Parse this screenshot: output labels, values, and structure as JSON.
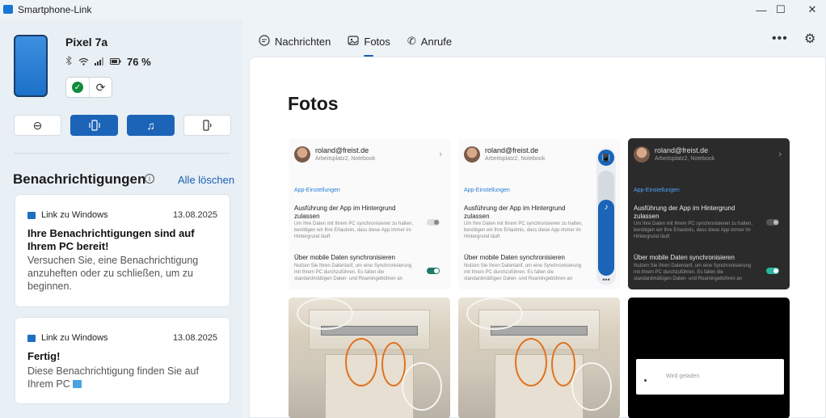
{
  "window": {
    "title": "Smartphone-Link",
    "minimize": "—",
    "maximize": "☐",
    "close": "✕"
  },
  "device": {
    "name": "Pixel 7a",
    "battery": "76 %",
    "status_icons": [
      "bluetooth-icon",
      "wifi-icon",
      "signal-icon",
      "battery-icon"
    ],
    "connected_glyph": "✓",
    "sync_glyph": "⟳"
  },
  "modes": [
    {
      "name": "do-not-disturb",
      "glyph": "⊖",
      "active": false
    },
    {
      "name": "vibrate",
      "glyph": "📳",
      "active": true
    },
    {
      "name": "ring",
      "glyph": "♫",
      "active": true
    },
    {
      "name": "audio-output",
      "glyph": "🔈",
      "active": false
    }
  ],
  "notifications": {
    "heading": "Benachrichtigungen",
    "info_glyph": "i",
    "clear_all": "Alle löschen",
    "cards": [
      {
        "app": "Link zu Windows",
        "date": "13.08.2025",
        "title": "Ihre Benachrichtigungen sind auf Ihrem PC bereit!",
        "body": "Versuchen Sie, eine Benachrichtigung anzuheften oder zu schließen, um zu beginnen."
      },
      {
        "app": "Link zu Windows",
        "date": "13.08.2025",
        "title": "Fertig!",
        "body": "Diese Benachrichtigung finden Sie auf Ihrem PC"
      }
    ]
  },
  "tabs": [
    {
      "label": "Nachrichten",
      "icon": "chat-icon",
      "glyph": "💬",
      "active": false
    },
    {
      "label": "Fotos",
      "icon": "photo-icon",
      "glyph": "🖼",
      "active": true
    },
    {
      "label": "Anrufe",
      "icon": "phone-icon",
      "glyph": "✆",
      "active": false
    }
  ],
  "toolbar": {
    "more_glyph": "•••",
    "settings_glyph": "⚙"
  },
  "main": {
    "title": "Fotos"
  },
  "screenshot_text": {
    "account": "roland@freist.de",
    "subtitle": "Arbeitsplatz2, Notebook",
    "chevron": "›",
    "section": "App-Einstellungen",
    "setting1_title": "Ausführung der App im Hintergrund zulassen",
    "setting1_desc": "Um Ihre Daten mit Ihrem PC synchronisieren zu halten, benötigen wir Ihre Erlaubnis, dass diese App immer im Hintergrund läuft",
    "setting2_title": "Über mobile Daten synchronisieren",
    "setting2_desc": "Nutzen Sie Ihren Datentarif, um eine Synchronisierung mit Ihrem PC durchzuführen. Es fallen die standardmäßigen Daten- und Roamingebühren an",
    "volume_note": "♪",
    "volume_top": "📳",
    "volume_more": "•••",
    "volume_level": 0.72,
    "dialog_text": "Wird geladen"
  }
}
